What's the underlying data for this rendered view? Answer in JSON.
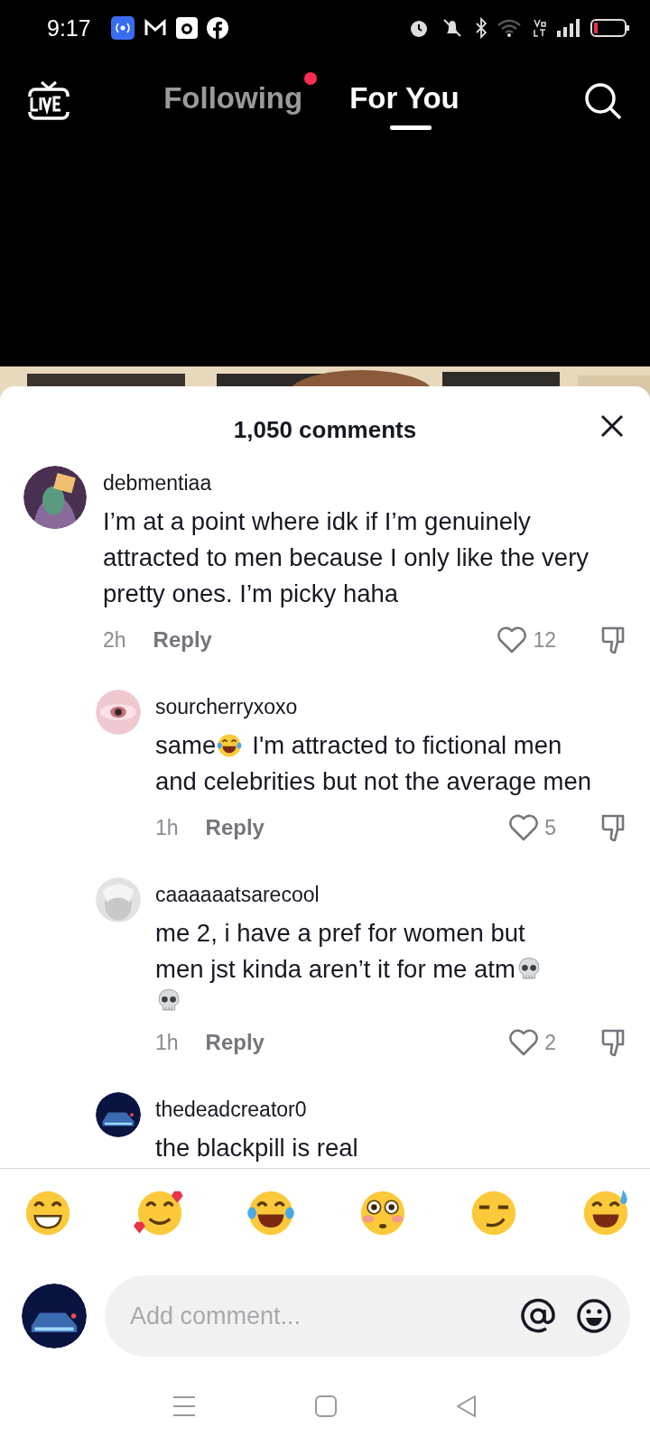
{
  "status_bar": {
    "time": "9:17"
  },
  "top_nav": {
    "tabs": [
      {
        "label": "Following",
        "selected": false,
        "notification_dot": true
      },
      {
        "label": "For You",
        "selected": true,
        "notification_dot": false
      }
    ]
  },
  "comments_sheet": {
    "title": "1,050 comments",
    "comments": [
      {
        "username": "debmentiaa",
        "lines": [
          [
            {
              "kind": "text",
              "text": "I’m at a point where idk if I’m genuinely attracted to men because I only like the very pretty ones. I’m picky haha"
            }
          ]
        ],
        "time": "2h",
        "reply_label": "Reply",
        "likes": "12",
        "children": [
          {
            "username": "sourcherryxoxo",
            "lines": [
              [
                {
                  "kind": "text",
                  "text": "same"
                },
                {
                  "kind": "laughing"
                },
                {
                  "kind": "text",
                  "text": "I'm attracted to fictional men"
                }
              ],
              [
                {
                  "kind": "text",
                  "text": "and celebrities but not the average men"
                }
              ]
            ],
            "time": "1h",
            "reply_label": "Reply",
            "likes": "5"
          },
          {
            "username": "caaaaaatsarecool",
            "lines": [
              [
                {
                  "kind": "text",
                  "text": "me 2, i have a pref for women but"
                }
              ],
              [
                {
                  "kind": "text",
                  "text": "men jst kinda aren’t it for me atm"
                },
                {
                  "kind": "skull"
                }
              ],
              [
                {
                  "kind": "skull"
                }
              ]
            ],
            "time": "1h",
            "reply_label": "Reply",
            "likes": "2"
          },
          {
            "username": "thedeadcreator0",
            "lines": [
              [
                {
                  "kind": "text",
                  "text": "the blackpill is real"
                }
              ]
            ]
          }
        ]
      }
    ]
  },
  "emoji_bar": [
    {
      "kind": "grin"
    },
    {
      "kind": "hearts"
    },
    {
      "kind": "joy"
    },
    {
      "kind": "flushed"
    },
    {
      "kind": "smirk"
    },
    {
      "kind": "sweat"
    }
  ],
  "comment_input": {
    "placeholder": "Add comment..."
  }
}
